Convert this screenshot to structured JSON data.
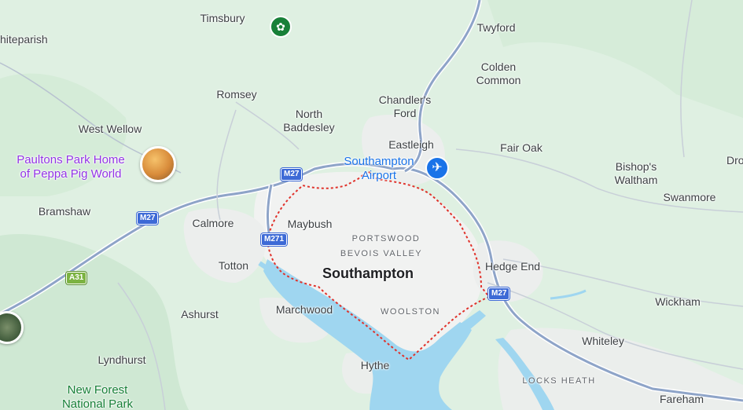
{
  "map": {
    "colors": {
      "land": "#dff0e2",
      "urban": "#eef0ee",
      "water": "#9fd6f0",
      "boundary": "#e0322b",
      "motorway": "#8ea4c8"
    },
    "city": {
      "name": "Southampton"
    },
    "districts": [
      {
        "name": "PORTSWOOD"
      },
      {
        "name": "BEVOIS VALLEY"
      },
      {
        "name": "WOOLSTON"
      },
      {
        "name": "LOCKS HEATH"
      }
    ],
    "places": [
      {
        "name": "Timsbury"
      },
      {
        "name": "Twyford"
      },
      {
        "name": "hiteparish"
      },
      {
        "name": "Colden\nCommon"
      },
      {
        "name": "Romsey"
      },
      {
        "name": "Chandler's\nFord"
      },
      {
        "name": "North\nBaddesley"
      },
      {
        "name": "West Wellow"
      },
      {
        "name": "Eastleigh"
      },
      {
        "name": "Fair Oak"
      },
      {
        "name": "Bishop's\nWaltham"
      },
      {
        "name": "Swanmore"
      },
      {
        "name": "Bramshaw"
      },
      {
        "name": "Calmore"
      },
      {
        "name": "Maybush"
      },
      {
        "name": "Totton"
      },
      {
        "name": "Hedge End"
      },
      {
        "name": "Marchwood"
      },
      {
        "name": "Ashurst"
      },
      {
        "name": "Wickham"
      },
      {
        "name": "Whiteley"
      },
      {
        "name": "Lyndhurst"
      },
      {
        "name": "Hythe"
      },
      {
        "name": "Fareham"
      },
      {
        "name": "Dro"
      }
    ],
    "pois": [
      {
        "name": "Paultons Park Home\nof Peppa Pig World",
        "kind": "theme-park"
      },
      {
        "name": "Southampton\nAirport",
        "kind": "airport"
      },
      {
        "name": "New Forest\nNational Park",
        "kind": "park"
      }
    ],
    "roads": [
      {
        "ref": "M27"
      },
      {
        "ref": "M27"
      },
      {
        "ref": "M271"
      },
      {
        "ref": "M27"
      },
      {
        "ref": "A31"
      }
    ],
    "icons": [
      "flower-icon",
      "airplane-icon",
      "theme-park-photo-icon",
      "forest-photo-icon"
    ]
  }
}
